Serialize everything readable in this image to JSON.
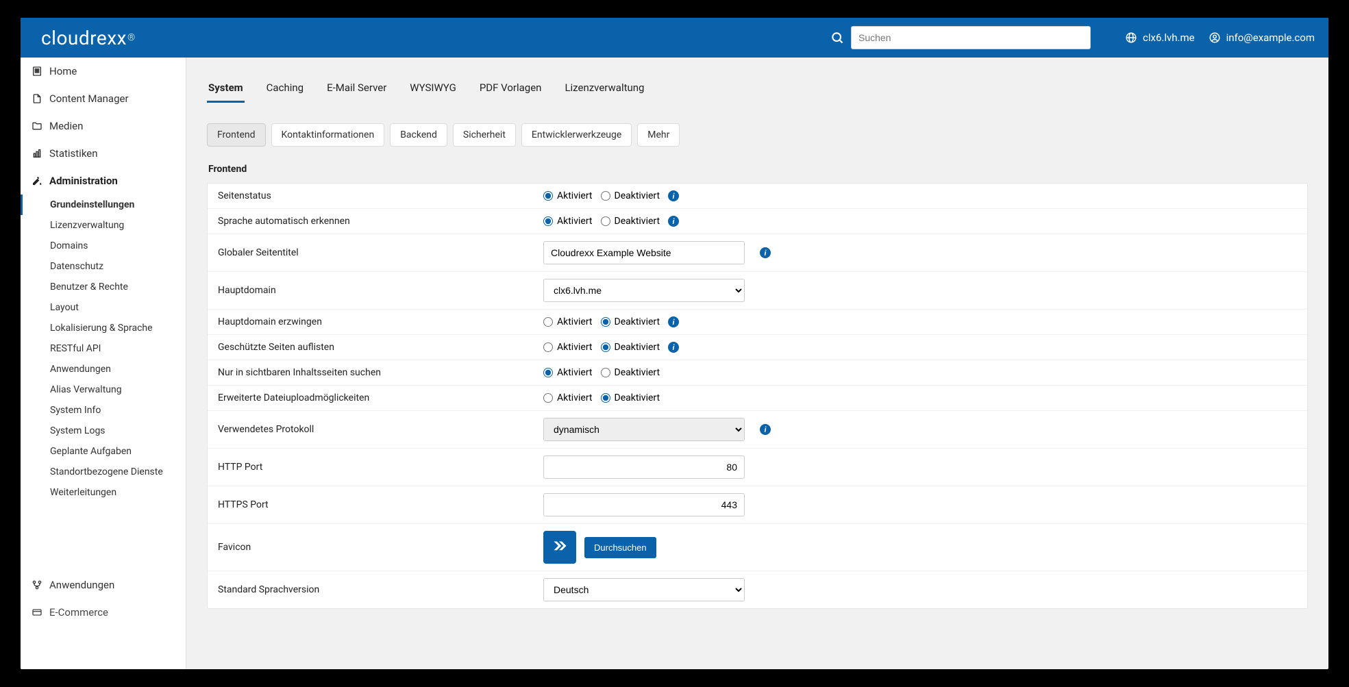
{
  "header": {
    "logo": "cloudrexx",
    "search_placeholder": "Suchen",
    "domain": "clx6.lvh.me",
    "user_email": "info@example.com"
  },
  "sidebar": {
    "home": "Home",
    "content_manager": "Content Manager",
    "medien": "Medien",
    "statistiken": "Statistiken",
    "administration": "Administration",
    "admin_items": [
      "Grundeinstellungen",
      "Lizenzverwaltung",
      "Domains",
      "Datenschutz",
      "Benutzer & Rechte",
      "Layout",
      "Lokalisierung & Sprache",
      "RESTful API",
      "Anwendungen",
      "Alias Verwaltung",
      "System Info",
      "System Logs",
      "Geplante Aufgaben",
      "Standortbezogene Dienste",
      "Weiterleitungen"
    ],
    "anwendungen": "Anwendungen",
    "ecommerce": "E-Commerce"
  },
  "tabs_primary": [
    "System",
    "Caching",
    "E-Mail Server",
    "WYSIWYG",
    "PDF Vorlagen",
    "Lizenzverwaltung"
  ],
  "tabs_secondary": [
    "Frontend",
    "Kontaktinformationen",
    "Backend",
    "Sicherheit",
    "Entwicklerwerkzeuge",
    "Mehr"
  ],
  "section_title": "Frontend",
  "labels": {
    "activated": "Aktiviert",
    "deactivated": "Deaktiviert",
    "browse": "Durchsuchen"
  },
  "rows": {
    "seitenstatus": {
      "label": "Seitenstatus",
      "value": "on"
    },
    "sprache_auto": {
      "label": "Sprache automatisch erkennen",
      "value": "on"
    },
    "globaler_titel": {
      "label": "Globaler Seitentitel",
      "value": "Cloudrexx Example Website"
    },
    "hauptdomain": {
      "label": "Hauptdomain",
      "value": "clx6.lvh.me"
    },
    "hauptdomain_erzwingen": {
      "label": "Hauptdomain erzwingen",
      "value": "off"
    },
    "geschuetzte": {
      "label": "Geschützte Seiten auflisten",
      "value": "off"
    },
    "sichtbare_suchen": {
      "label": "Nur in sichtbaren Inhaltsseiten suchen",
      "value": "on"
    },
    "dateiupload": {
      "label": "Erweiterte Dateiuploadmöglickeiten",
      "value": "off"
    },
    "protokoll": {
      "label": "Verwendetes Protokoll",
      "value": "dynamisch"
    },
    "http_port": {
      "label": "HTTP Port",
      "value": "80"
    },
    "https_port": {
      "label": "HTTPS Port",
      "value": "443"
    },
    "favicon": {
      "label": "Favicon"
    },
    "standard_sprache": {
      "label": "Standard Sprachversion",
      "value": "Deutsch"
    }
  }
}
